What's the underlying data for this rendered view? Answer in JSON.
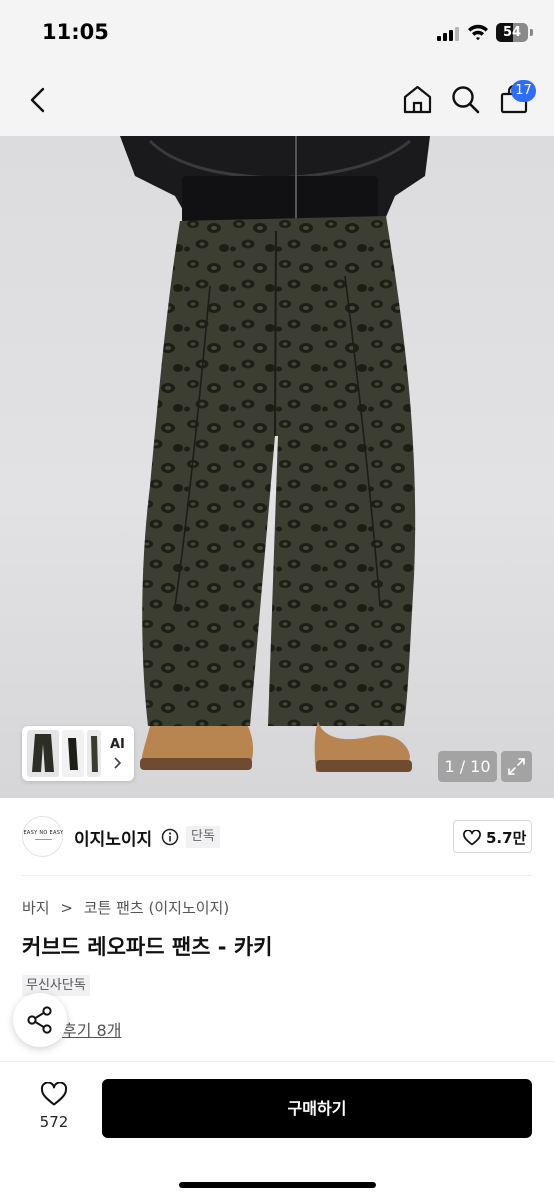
{
  "status_bar": {
    "time": "11:05",
    "battery_level": "54",
    "icons": [
      "signal-icon",
      "wifi-icon",
      "battery-icon"
    ]
  },
  "nav": {
    "icons": [
      "back-arrow-icon",
      "home-icon",
      "search-icon",
      "shopping-bag-icon"
    ],
    "cart_count": "17"
  },
  "gallery": {
    "ai_label": "AI",
    "counter": "1 / 10",
    "icons": [
      "chevron-right-icon",
      "expand-icon"
    ]
  },
  "brand": {
    "logo_text": "EASY NO EASY",
    "name": "이지노이지",
    "badge": "단독",
    "like_count": "5.7만",
    "icons": [
      "info-icon",
      "heart-outline-icon"
    ]
  },
  "product": {
    "breadcrumb": [
      "바지",
      "코튼 팬츠 (이지노이지)"
    ],
    "breadcrumb_separator": ">",
    "title": "커브드 레오파드 팬츠 - 카키",
    "store_badge": "무신사단독",
    "reviews": "후기 8개"
  },
  "bottom_bar": {
    "wish_count": "572",
    "buy_label": "구매하기",
    "icons": [
      "heart-outline-icon",
      "share-icon"
    ]
  },
  "colors": {
    "background": "#ffffff",
    "header_bg": "#f4f4f4",
    "badge_blue": "#2f6df6",
    "buy_button": "#000000",
    "pants_khaki": "#3a3d2f",
    "boot_tan": "#b8844f"
  }
}
